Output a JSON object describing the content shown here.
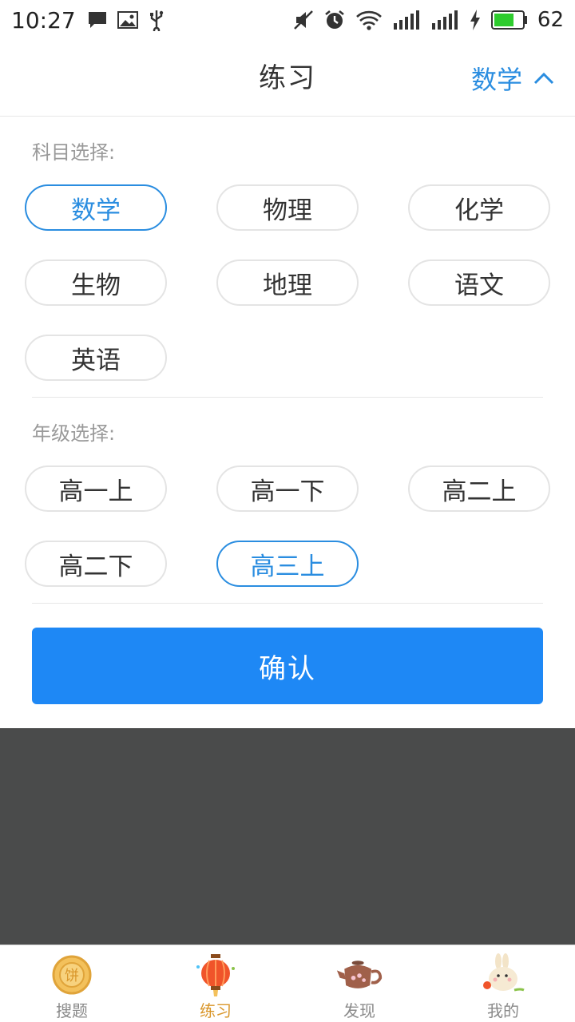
{
  "status_bar": {
    "time": "10:27",
    "battery_level": "62",
    "icons_left": [
      "message-icon",
      "image-icon",
      "usb-icon"
    ],
    "icons_right": [
      "mute-icon",
      "alarm-icon",
      "wifi-icon",
      "signal-icon",
      "signal-icon",
      "charging-icon",
      "battery-icon"
    ],
    "battery_fill_color": "#2ecc2e"
  },
  "header": {
    "title": "练习",
    "subject_toggle_label": "数学",
    "accent_color": "#2a8de0"
  },
  "subjects": {
    "label": "科目选择:",
    "items": [
      "数学",
      "物理",
      "化学",
      "生物",
      "地理",
      "语文",
      "英语"
    ],
    "selected": "数学"
  },
  "grades": {
    "label": "年级选择:",
    "items": [
      "高一上",
      "高一下",
      "高二上",
      "高二下",
      "高三上"
    ],
    "selected": "高三上"
  },
  "confirm_label": "确认",
  "confirm_color": "#1e88f5",
  "bottom_nav": {
    "items": [
      {
        "label": "搜题",
        "icon": "mooncake-icon"
      },
      {
        "label": "练习",
        "icon": "lantern-icon"
      },
      {
        "label": "发现",
        "icon": "teapot-icon"
      },
      {
        "label": "我的",
        "icon": "rabbit-icon"
      }
    ],
    "active": "练习",
    "active_color": "#d9962a"
  }
}
